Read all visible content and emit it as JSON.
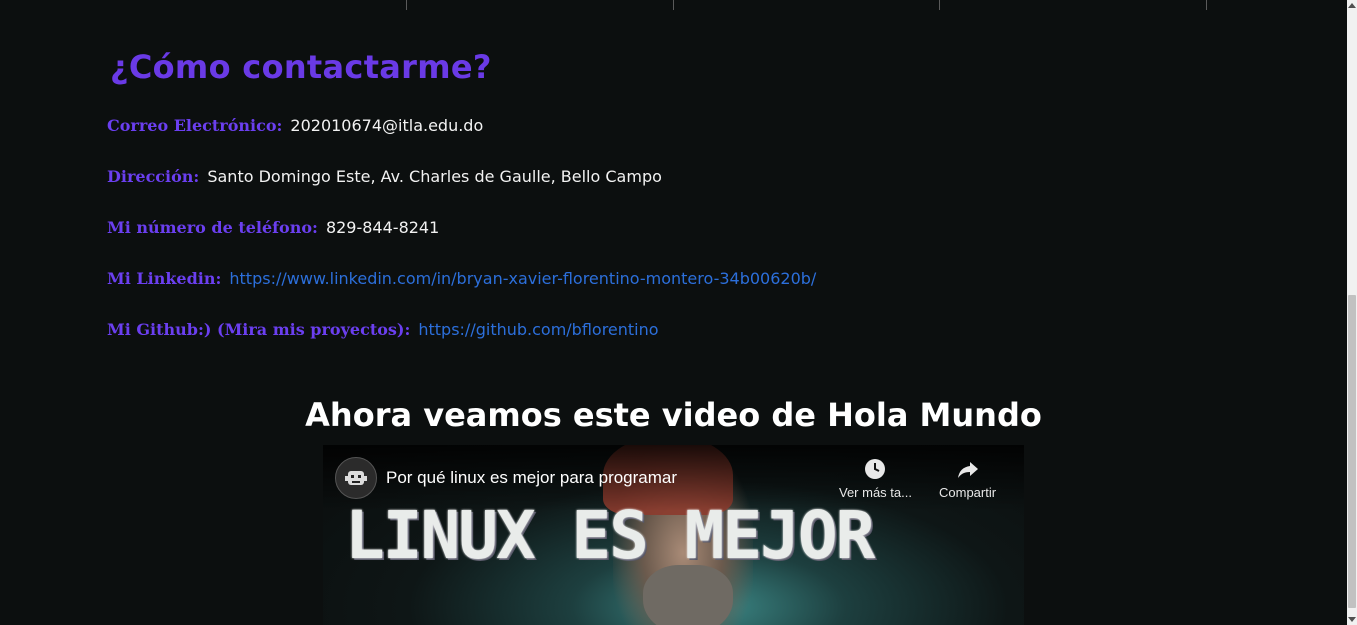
{
  "contact": {
    "heading": "¿Cómo contactarme?",
    "rows": [
      {
        "label": "Correo Electrónico:",
        "value": "202010674@itla.edu.do"
      },
      {
        "label": "Dirección:",
        "value": "Santo Domingo Este, Av. Charles de Gaulle, Bello Campo"
      },
      {
        "label": "Mi número de teléfono:",
        "value": "829-844-8241"
      },
      {
        "label": "Mi Linkedin:",
        "link": "https://www.linkedin.com/in/bryan-xavier-florentino-montero-34b00620b/"
      },
      {
        "label": "Mi Github:) (Mira mis proyectos):",
        "link": "https://github.com/bflorentino"
      }
    ]
  },
  "video_section": {
    "heading": "Ahora veamos este video de Hola Mundo",
    "video_title": "Por qué linux es mejor para programar",
    "thumbnail_text": "LINUX ES MEJOR",
    "watch_later_label": "Ver más ta...",
    "share_label": "Compartir"
  },
  "icons": {
    "channel": "channel-avatar-icon",
    "clock": "clock-icon",
    "share": "share-icon"
  },
  "colors": {
    "background": "#0c0f0f",
    "accent_purple": "#6a3ae6",
    "link_blue": "#2c6fdb",
    "text": "#f2f2f2"
  }
}
